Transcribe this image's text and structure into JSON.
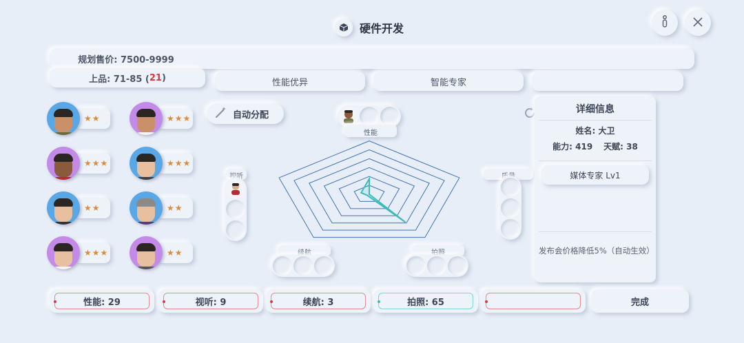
{
  "title": "硬件开发",
  "header": {
    "icon": "box-icon",
    "info_icon": "info-icon",
    "close_icon": "close-icon"
  },
  "pricing": {
    "price_label": "规划售价: 7500-9999",
    "quality_prefix": "上品: 71-85 (",
    "quality_value": "21",
    "quality_suffix": ")"
  },
  "tags": [
    "性能优异",
    "智能专家",
    ""
  ],
  "staff": [
    {
      "stars": "★★",
      "ring": "#5aa7e6"
    },
    {
      "stars": "★★★",
      "ring": "#c48ae8"
    },
    {
      "stars": "★★★",
      "ring": "#c48ae8"
    },
    {
      "stars": "★★★",
      "ring": "#5aa7e6"
    },
    {
      "stars": "★★",
      "ring": "#5aa7e6"
    },
    {
      "stars": "★★",
      "ring": "#5aa7e6"
    },
    {
      "stars": "★★★",
      "ring": "#c48ae8"
    },
    {
      "stars": "★★",
      "ring": "#c48ae8"
    }
  ],
  "auto_assign": {
    "label": "自动分配",
    "icon": "magic-wand-icon"
  },
  "refresh_icon": "refresh-icon",
  "radar": {
    "axes": [
      "性能",
      "质量",
      "拍照",
      "续航",
      "视听"
    ],
    "levels": 6,
    "values": [
      29,
      0,
      65,
      3,
      9
    ],
    "line_color": "#3e73b5",
    "value_color": "#3cbcb8"
  },
  "detail": {
    "title": "详细信息",
    "name": "姓名: 大卫",
    "ability": "能力: 419",
    "talent": "天赋: 38",
    "badge": "媒体专家 Lv1",
    "effect": "发布会价格降低5%（自动生效）"
  },
  "stats": [
    {
      "label": "性能: 29",
      "border": "#e58a95"
    },
    {
      "label": "视听: 9",
      "border": "#e58a95"
    },
    {
      "label": "续航: 3",
      "border": "#e58a95"
    },
    {
      "label": "拍照: 65",
      "border": "#7ad8cf"
    },
    {
      "label": "",
      "border": "#e58a95"
    }
  ],
  "done_label": "完成"
}
